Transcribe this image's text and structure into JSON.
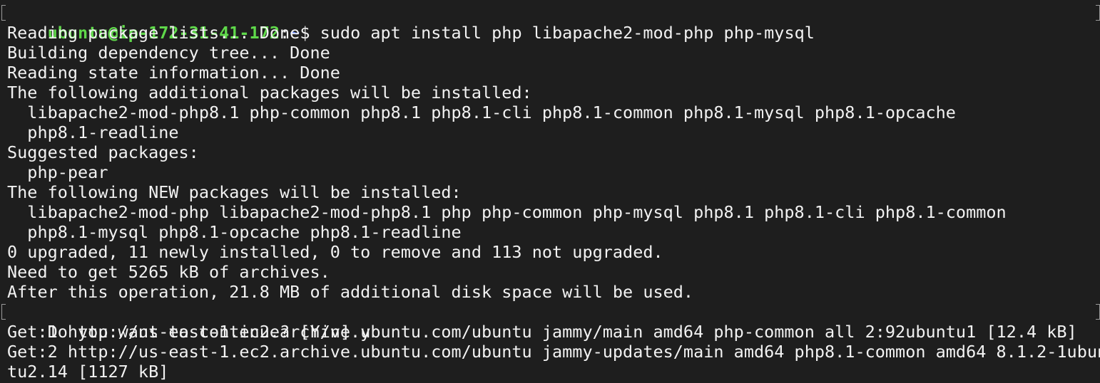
{
  "prompt": {
    "user_host": "ubuntu@ip-172-31-41-172",
    "separator": ":",
    "path": "~",
    "symbol": "$ ",
    "command": "sudo apt install php libapache2-mod-php php-mysql"
  },
  "output_lines": [
    "Reading package lists... Done",
    "Building dependency tree... Done",
    "Reading state information... Done",
    "The following additional packages will be installed:",
    "  libapache2-mod-php8.1 php-common php8.1 php8.1-cli php8.1-common php8.1-mysql php8.1-opcache",
    "  php8.1-readline",
    "Suggested packages:",
    "  php-pear",
    "The following NEW packages will be installed:",
    "  libapache2-mod-php libapache2-mod-php8.1 php php-common php-mysql php8.1 php8.1-cli php8.1-common",
    "  php8.1-mysql php8.1-opcache php8.1-readline",
    "0 upgraded, 11 newly installed, 0 to remove and 113 not upgraded.",
    "Need to get 5265 kB of archives.",
    "After this operation, 21.8 MB of additional disk space will be used.",
    "Do you want to continue? [Y/n] y",
    "Get:1 http://us-east-1.ec2.archive.ubuntu.com/ubuntu jammy/main amd64 php-common all 2:92ubuntu1 [12.4 kB]",
    "Get:2 http://us-east-1.ec2.archive.ubuntu.com/ubuntu jammy-updates/main amd64 php8.1-common amd64 8.1.2-1ubun",
    "tu2.14 [1127 kB]"
  ]
}
